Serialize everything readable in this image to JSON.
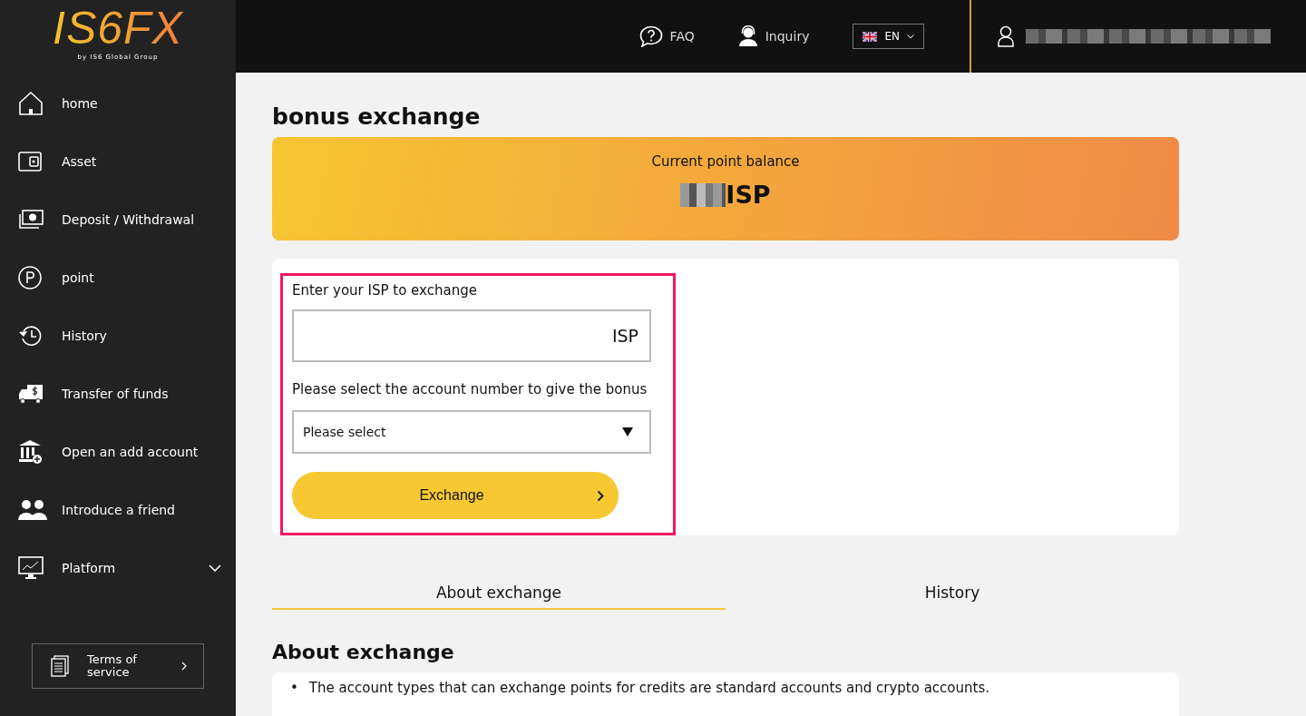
{
  "logo": {
    "mark": "IS6FX",
    "tagline": "by IS6 Global Group"
  },
  "sidebar": {
    "items": [
      {
        "label": "home",
        "kind": "home"
      },
      {
        "label": "Asset",
        "kind": "wallet"
      },
      {
        "label": "Deposit / Withdrawal",
        "kind": "cash"
      },
      {
        "label": "point",
        "kind": "point"
      },
      {
        "label": "History",
        "kind": "history"
      },
      {
        "label": "Transfer of funds",
        "kind": "truck"
      },
      {
        "label": "Open an add account",
        "kind": "bank"
      },
      {
        "label": "Introduce a friend",
        "kind": "people"
      },
      {
        "label": "Platform",
        "kind": "monitor",
        "expanded": false
      }
    ],
    "terms_button": "Terms of service"
  },
  "header": {
    "faq": "FAQ",
    "inquiry": "Inquiry",
    "language": "EN"
  },
  "page_title": "bonus exchange",
  "balance": {
    "label": "Current point balance",
    "unit": "ISP"
  },
  "form": {
    "amount_label": "Enter your ISP to exchange",
    "amount_unit": "ISP",
    "account_label": "Please select the account number to give the bonus",
    "account_select": "Please select",
    "submit": "Exchange",
    "highlighted": true
  },
  "tabs": [
    {
      "label": "About exchange",
      "selected": true
    },
    {
      "label": "History",
      "selected": false
    }
  ],
  "about": {
    "title": "About exchange",
    "items": [
      {
        "marker": "•",
        "text": "The account types that can exchange points for credits are standard accounts and crypto accounts."
      }
    ]
  }
}
